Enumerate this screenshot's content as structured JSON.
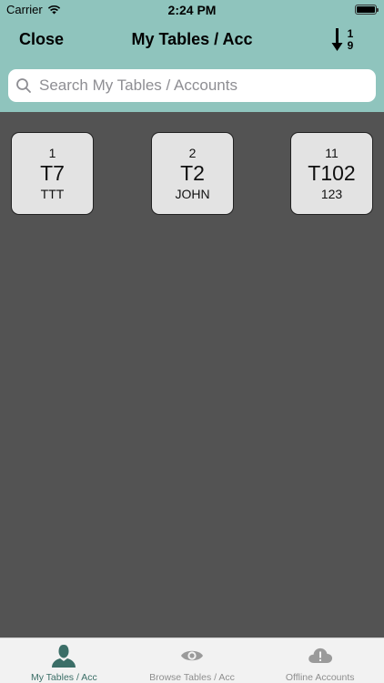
{
  "status_bar": {
    "carrier": "Carrier",
    "time": "2:24 PM"
  },
  "nav": {
    "close_label": "Close",
    "title": "My Tables / Acc",
    "sort_icon": "sort-numeric-down-icon",
    "sort_digits_top": "1",
    "sort_digits_bottom": "9"
  },
  "search": {
    "placeholder": "Search My Tables / Accounts",
    "value": ""
  },
  "tables": [
    {
      "number": "1",
      "name": "T7",
      "account": "TTT"
    },
    {
      "number": "2",
      "name": "T2",
      "account": "JOHN"
    },
    {
      "number": "11",
      "name": "T102",
      "account": "123"
    }
  ],
  "tab_bar": {
    "tabs": [
      {
        "label": "My Tables / Acc",
        "icon": "person-icon",
        "active": true
      },
      {
        "label": "Browse Tables / Acc",
        "icon": "eye-icon",
        "active": false
      },
      {
        "label": "Offline Accounts",
        "icon": "cloud-alert-icon",
        "active": false
      }
    ]
  },
  "colors": {
    "header_bg": "#8fc4bd",
    "content_bg": "#535353",
    "tile_bg": "#e3e3e3",
    "active_tab": "#3b6e67",
    "inactive_tab": "#8e8e8e"
  }
}
